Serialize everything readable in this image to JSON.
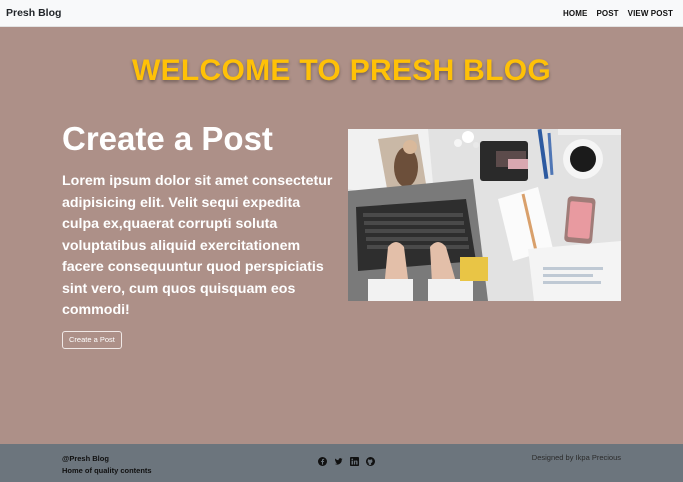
{
  "navbar": {
    "brand": "Presh Blog",
    "links": [
      "HOME",
      "POST",
      "VIEW POST"
    ]
  },
  "hero": {
    "welcome": "WELCOME TO PRESH BLOG",
    "heading": "Create a Post",
    "body": "Lorem ipsum dolor sit amet consectetur adipisicing elit. Velit sequi expedita culpa ex,quaerat corrupti soluta voluptatibus aliquid exercitationem facere consequuntur quod perspiciatis sint vero, cum quos quisquam eos commodi!",
    "button": "Create a Post"
  },
  "footer": {
    "handle": "@Presh Blog",
    "tagline": "Home of quality contents",
    "icons": [
      "facebook-icon",
      "twitter-icon",
      "linkedin-icon",
      "github-icon"
    ],
    "credit": "Designed by Ikpa Precious"
  },
  "colors": {
    "background": "#ad9088",
    "accent": "#ffc107",
    "navbar": "#f8f9fa",
    "footer": "#6c757d"
  }
}
